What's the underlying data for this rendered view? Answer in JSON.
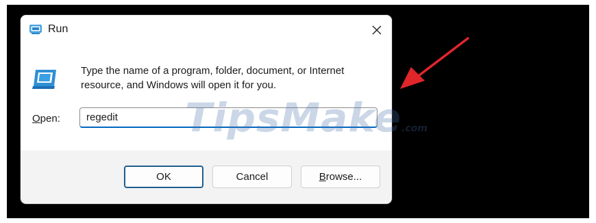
{
  "window": {
    "title": "Run",
    "icon": "run-app-icon"
  },
  "description": "Type the name of a program, folder, document, or Internet resource, and Windows will open it for you.",
  "open_field": {
    "label_accesskey": "O",
    "label_rest": "pen:",
    "value": "regedit"
  },
  "buttons": {
    "ok_label": "OK",
    "cancel_label": "Cancel",
    "browse_accesskey": "B",
    "browse_rest": "rowse..."
  },
  "watermark": {
    "text": "TipsMake",
    "tld": ".com"
  },
  "colors": {
    "accent": "#0067c0",
    "annotation_arrow": "#e0262b",
    "backdrop": "#000000"
  },
  "annotation": {
    "icon": "red-pointer-arrow"
  }
}
